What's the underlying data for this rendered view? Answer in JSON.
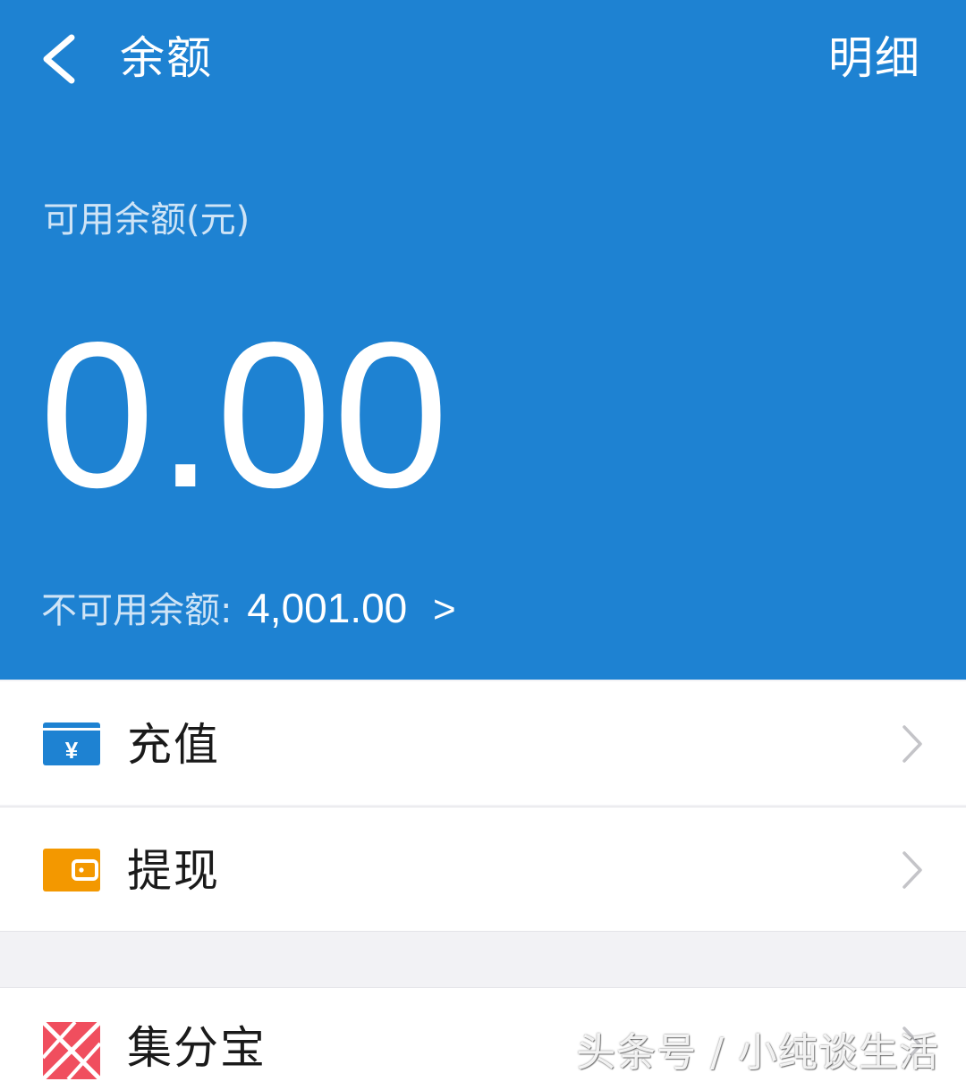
{
  "header": {
    "title": "余额",
    "detail_label": "明细",
    "background_color": "#1e82d2"
  },
  "balance": {
    "available_label": "可用余额(元)",
    "available_amount": "0.00",
    "frozen_label": "不可用余额:",
    "frozen_amount": "4,001.00",
    "frozen_arrow": ">"
  },
  "menu": {
    "items": [
      {
        "label": "充值",
        "icon": "recharge-card-icon",
        "icon_color": "#1e82d2"
      },
      {
        "label": "提现",
        "icon": "wallet-icon",
        "icon_color": "#f39800"
      },
      {
        "label": "集分宝",
        "icon": "jifenbao-icon",
        "icon_color": "#f04e5e"
      }
    ]
  },
  "watermark": {
    "text": "头条号 / 小纯谈生活"
  }
}
